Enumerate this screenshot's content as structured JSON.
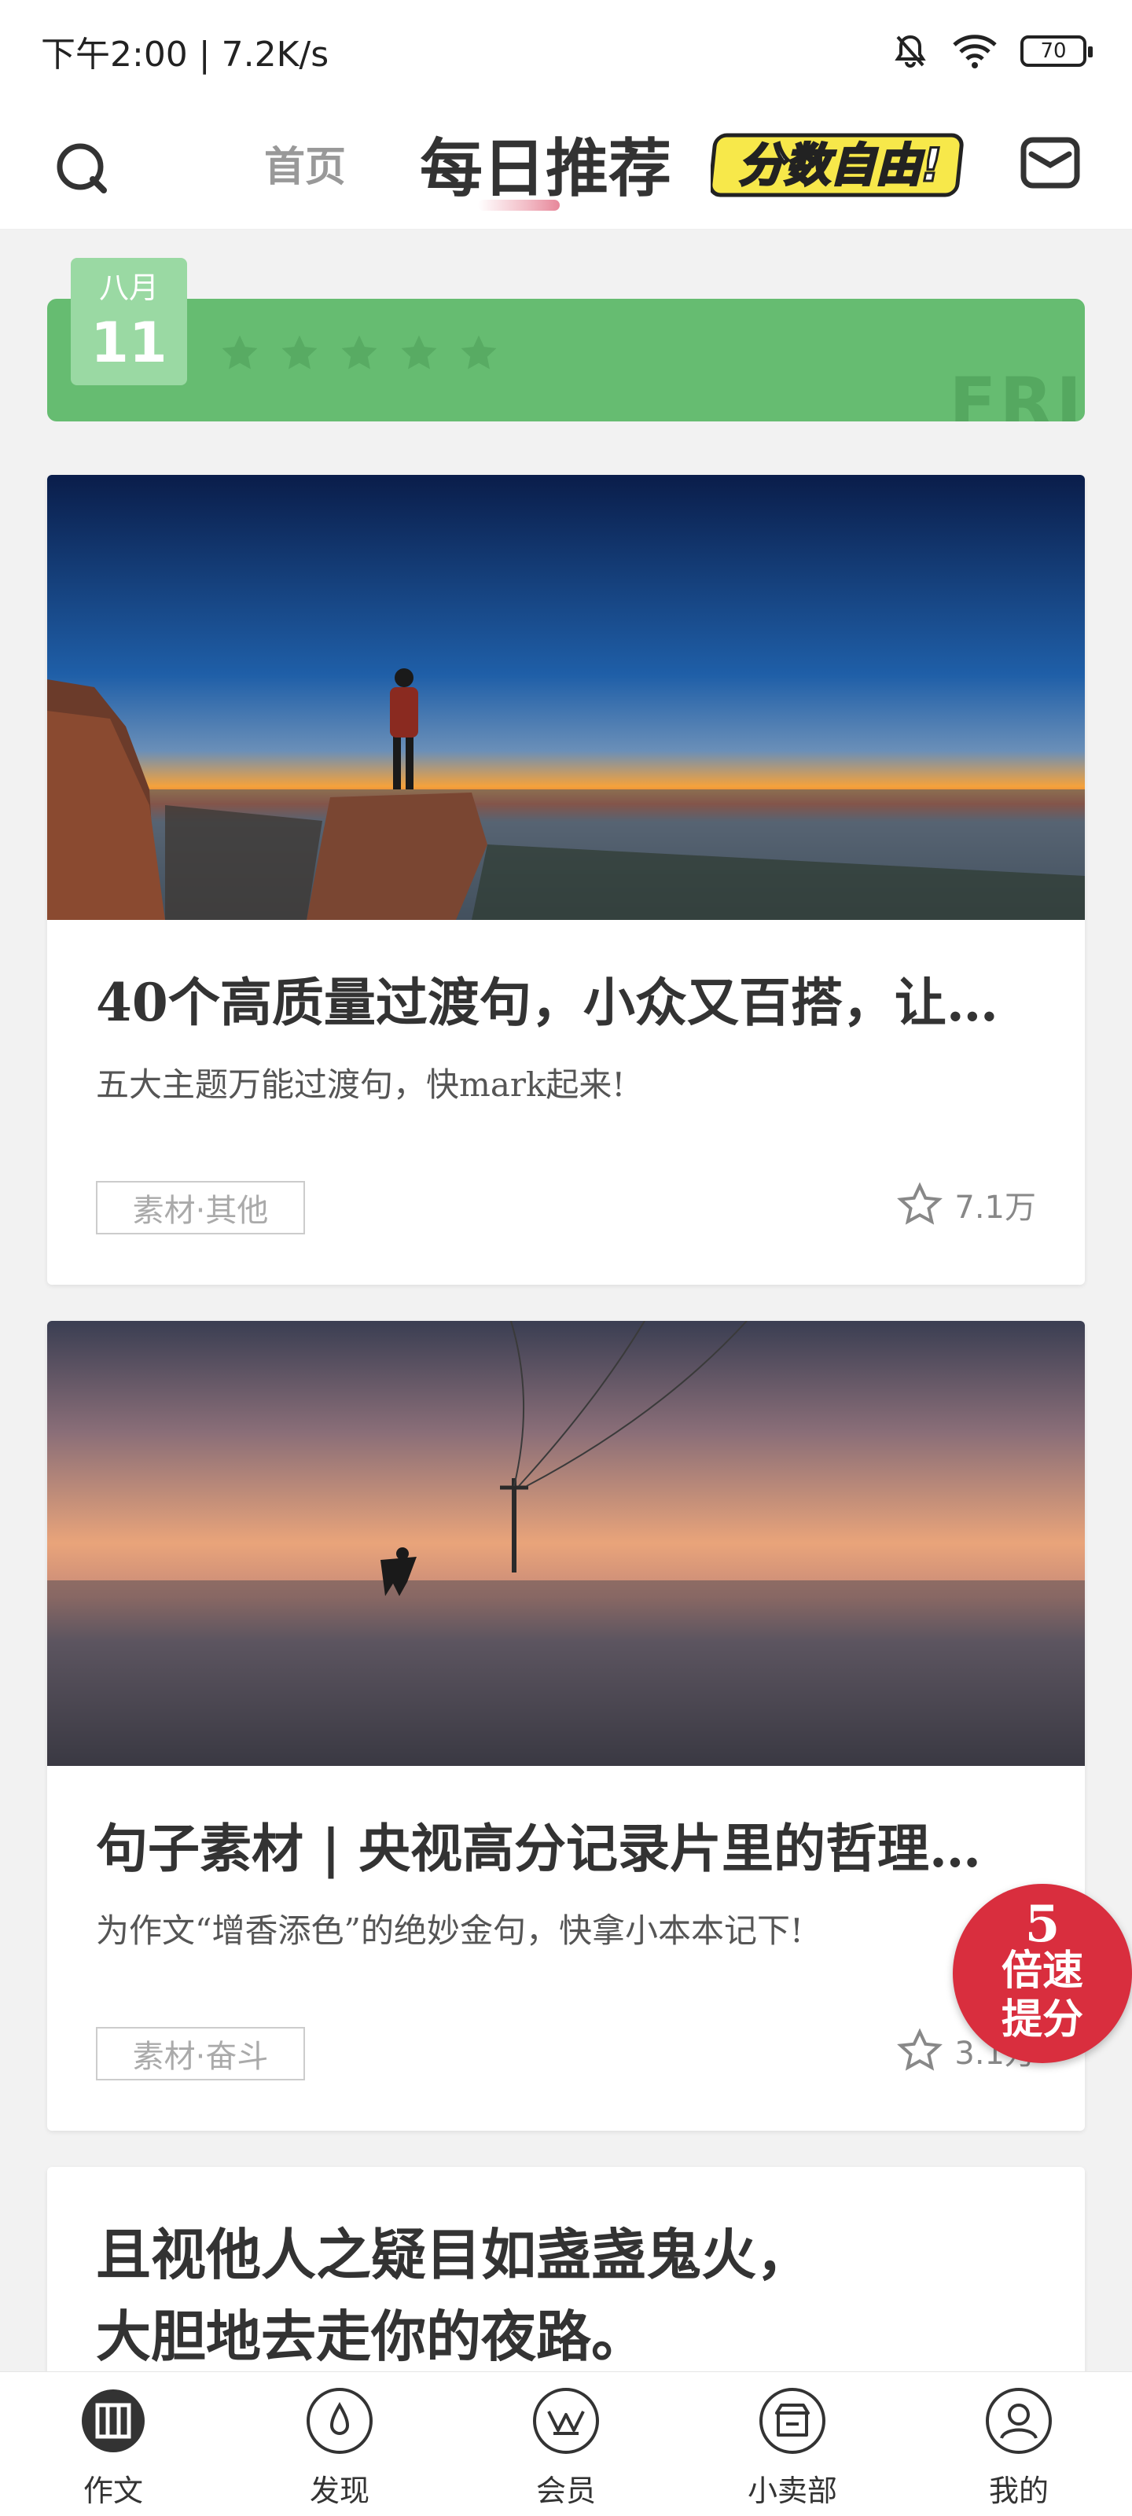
{
  "status_bar": {
    "time_speed": "下午2:00 | 7.2K/s",
    "battery": "70"
  },
  "header": {
    "tab_home": "首页",
    "tab_daily": "每日推荐",
    "promo_badge": "分数自由!"
  },
  "date_banner": {
    "month": "八月",
    "day": "11",
    "weekday": "FRI",
    "rating_stars": 5
  },
  "cards": [
    {
      "title": "40个高质量过渡句，小众又百搭，让…",
      "subtitle": "五大主题万能过渡句，快mark起来!",
      "tag": "素材·其他",
      "favorites": "7.1万"
    },
    {
      "title": "句子素材 | 央视高分记录片里的哲理…",
      "subtitle": "为作文“增香添色”的绝妙金句，快拿小本本记下!",
      "tag": "素材·奋斗",
      "favorites": "3.1万"
    }
  ],
  "quote": {
    "line1": "且视他人之疑目如盏盏鬼火，",
    "line2": "大胆地去走你的夜路。"
  },
  "bubble": {
    "number": "5",
    "line1": "倍速",
    "line2": "提分"
  },
  "bottom_nav": [
    {
      "label": "作文"
    },
    {
      "label": "发现"
    },
    {
      "label": "会员"
    },
    {
      "label": "小卖部"
    },
    {
      "label": "我的"
    }
  ],
  "colors": {
    "banner_green": "#66bc71",
    "date_card_green": "#9ad9a3",
    "bubble_red": "#d92e3e",
    "tab_accent": "#e7879a"
  }
}
